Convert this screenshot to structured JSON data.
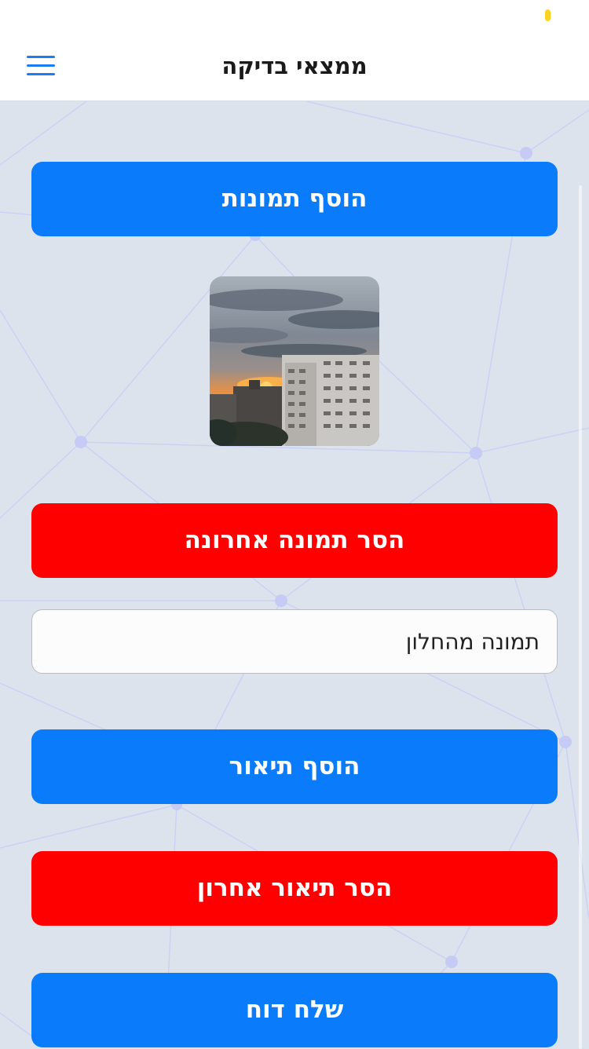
{
  "header": {
    "title": "ממצאי בדיקה",
    "menu_icon": "hamburger-menu-icon"
  },
  "actions": {
    "add_photos_label": "הוסף תמונות",
    "remove_last_photo_label": "הסר תמונה אחרונה",
    "add_description_label": "הוסף תיאור",
    "remove_last_description_label": "הסר תיאור אחרון",
    "send_report_label": "שלח דוח"
  },
  "description": {
    "value": "תמונה מהחלון"
  },
  "photos": {
    "count": 1
  },
  "colors": {
    "primary": "#0a7bfa",
    "danger": "#fe0000",
    "background": "#dde3ec",
    "status_indicator": "#ffd21f"
  }
}
